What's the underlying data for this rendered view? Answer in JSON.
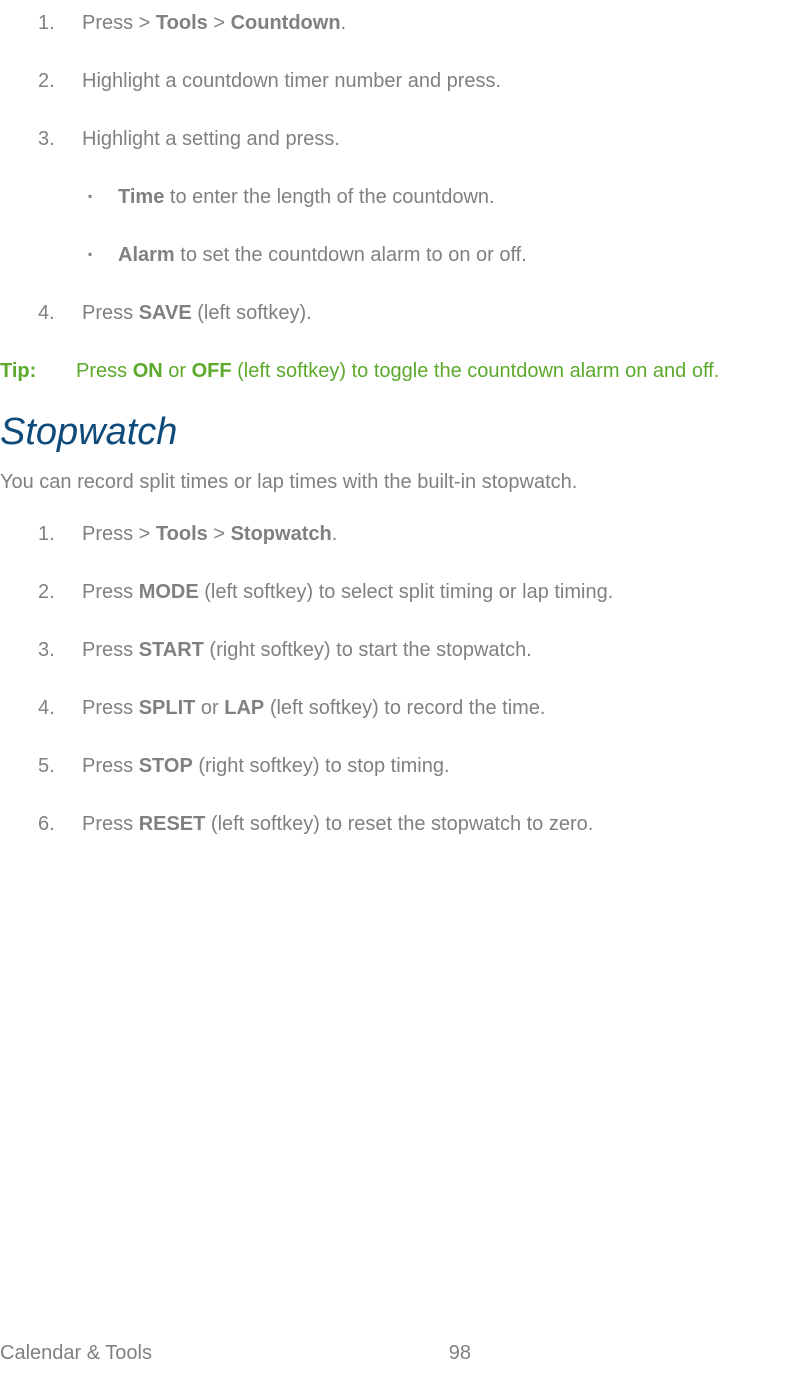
{
  "list1": {
    "item1_pre": "Press  > ",
    "item1_b1": "Tools",
    "item1_mid": " > ",
    "item1_b2": "Countdown",
    "item1_post": ".",
    "item2": "Highlight a countdown timer number and press.",
    "item3": "Highlight a setting and press.",
    "bullet1_b": "Time",
    "bullet1_t": " to enter the length of the countdown.",
    "bullet2_b": "Alarm",
    "bullet2_t": " to set the countdown alarm to on or off.",
    "item4_pre": "Press ",
    "item4_b": "SAVE",
    "item4_post": " (left softkey)."
  },
  "tip": {
    "label": "Tip:",
    "pre": "Press ",
    "b1": "ON",
    "mid1": " or ",
    "b2": "OFF",
    "post": " (left softkey) to toggle the countdown alarm on and off."
  },
  "heading": "Stopwatch",
  "intro": "You can record split times or lap times with the built-in stopwatch.",
  "list2": {
    "item1_pre": "Press  > ",
    "item1_b1": "Tools",
    "item1_mid": " > ",
    "item1_b2": "Stopwatch",
    "item1_post": ".",
    "item2_pre": "Press ",
    "item2_b": "MODE",
    "item2_post": " (left softkey) to select split timing or lap timing.",
    "item3_pre": "Press ",
    "item3_b": "START",
    "item3_post": " (right softkey) to start the stopwatch.",
    "item4_pre": "Press ",
    "item4_b1": "SPLIT",
    "item4_mid": " or ",
    "item4_b2": "LAP",
    "item4_post": " (left softkey) to record the time.",
    "item5_pre": "Press ",
    "item5_b": "STOP",
    "item5_post": " (right softkey) to stop timing.",
    "item6_pre": "Press ",
    "item6_b": "RESET",
    "item6_post": " (left softkey) to reset the stopwatch to zero."
  },
  "footer": {
    "left": "Calendar & Tools",
    "right": "98"
  }
}
